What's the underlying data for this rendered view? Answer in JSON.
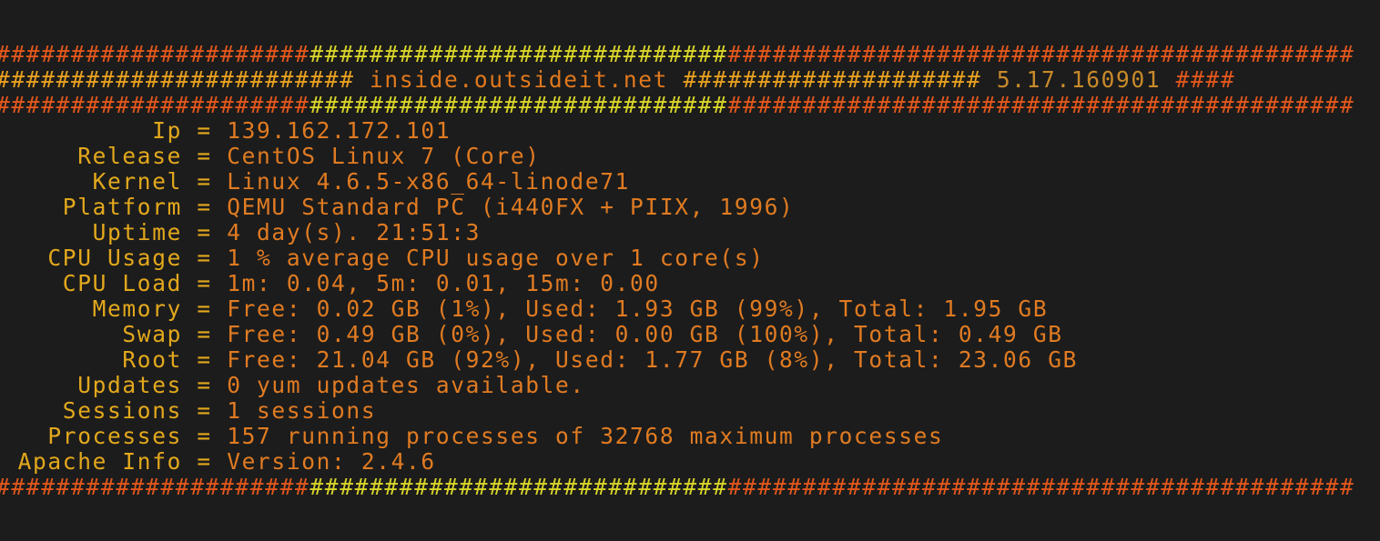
{
  "terminal": {
    "banner_top": {
      "left": "#####################",
      "middle": "############################",
      "right": "##########################################"
    },
    "banner_title": {
      "left_hashes": "########################",
      "hostname": "inside.outsideit.net",
      "mid_hashes": "####################",
      "version": "5.17.160901",
      "right_hashes": "####"
    },
    "banner_mid": {
      "left": "#####################",
      "middle": "############################",
      "right": "##########################################"
    },
    "rows": [
      {
        "label": "Ip",
        "value": "139.162.172.101"
      },
      {
        "label": "Release",
        "value": "CentOS Linux 7 (Core)"
      },
      {
        "label": "Kernel",
        "value": "Linux 4.6.5-x86_64-linode71"
      },
      {
        "label": "Platform",
        "value": "QEMU Standard PC (i440FX + PIIX, 1996)"
      },
      {
        "label": "Uptime",
        "value": "4 day(s). 21:51:3"
      },
      {
        "label": "CPU Usage",
        "value": "1 % average CPU usage over 1 core(s)"
      },
      {
        "label": "CPU Load",
        "value": "1m: 0.04, 5m: 0.01, 15m: 0.00"
      },
      {
        "label": "Memory",
        "value": "Free: 0.02 GB (1%), Used: 1.93 GB (99%), Total: 1.95 GB"
      },
      {
        "label": "Swap",
        "value": "Free: 0.49 GB (0%), Used: 0.00 GB (100%), Total: 0.49 GB"
      },
      {
        "label": "Root",
        "value": "Free: 21.04 GB (92%), Used: 1.77 GB (8%), Total: 23.06 GB"
      },
      {
        "label": "Updates",
        "value": "0 yum updates available."
      },
      {
        "label": "Sessions",
        "value": "1 sessions"
      },
      {
        "label": "Processes",
        "value": "157 running processes of 32768 maximum processes"
      },
      {
        "label": "Apache Info",
        "value": "Version: 2.4.6"
      }
    ],
    "equals": "=",
    "banner_bottom": {
      "left": "#####################",
      "middle": "############################",
      "right": "##########################################"
    }
  }
}
